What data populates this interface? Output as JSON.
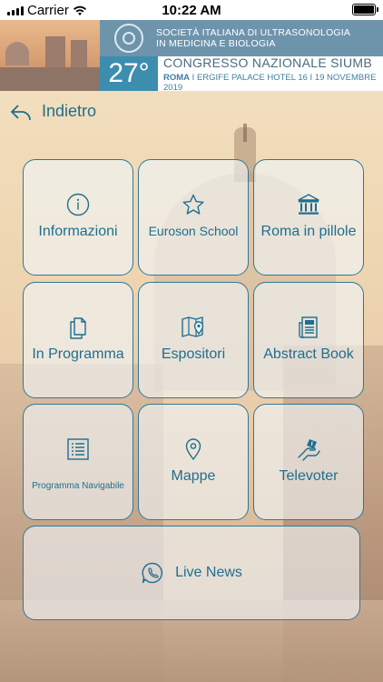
{
  "status_bar": {
    "carrier": "Carrier",
    "time": "10:22 AM",
    "battery_level": 1.0
  },
  "banner": {
    "society_line1": "SOCIETÀ ITALIANA DI ULTRASONOLOGIA",
    "society_line2": "IN MEDICINA E BIOLOGIA",
    "edition": "27°",
    "congress_title": "CONGRESSO NAZIONALE SIUMB",
    "city": "ROMA",
    "venue_rest": " I ERGIFE PALACE HOTEL 16 I 19 NOVEMBRE 2019"
  },
  "nav": {
    "back_label": "Indietro"
  },
  "menu": [
    {
      "label": "Informazioni",
      "icon": "info-icon"
    },
    {
      "label": "Euroson School",
      "icon": "star-icon"
    },
    {
      "label": "Roma in pillole",
      "icon": "bank-icon"
    },
    {
      "label": "In Programma",
      "icon": "documents-icon"
    },
    {
      "label": "Espositori",
      "icon": "map-pin-icon"
    },
    {
      "label": "Abstract Book",
      "icon": "newspaper-icon"
    },
    {
      "label": "Programma Navigabile",
      "icon": "list-icon"
    },
    {
      "label": "Mappe",
      "icon": "location-pin-icon"
    },
    {
      "label": "Televoter",
      "icon": "hand-vote-icon"
    }
  ],
  "live": {
    "label": "Live News",
    "icon": "chat-bubble-icon"
  },
  "colors": {
    "accent": "#1f6e8f",
    "banner_blue": "#6e94ac",
    "edition_blue": "#3d8dae"
  }
}
